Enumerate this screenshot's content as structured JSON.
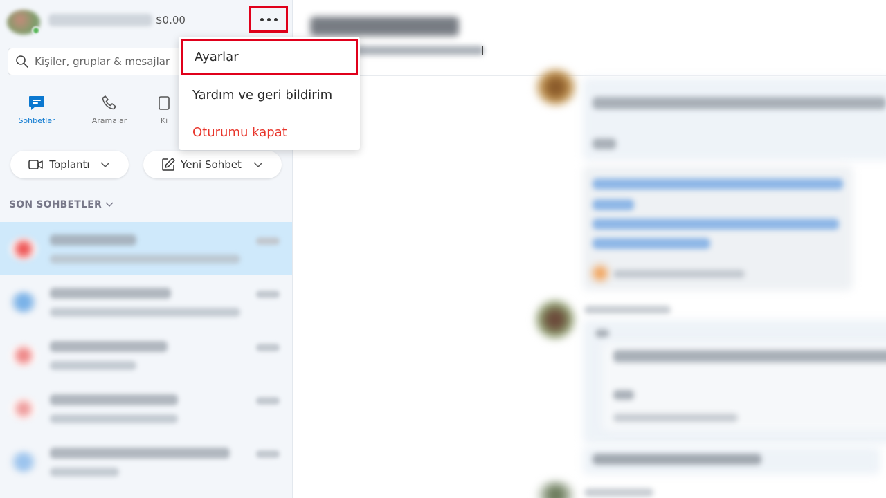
{
  "profile": {
    "credit": "$0.00"
  },
  "search": {
    "placeholder": "Kişiler, gruplar & mesajlar"
  },
  "nav": {
    "items": [
      {
        "label": "Sohbetler",
        "icon": "chat-icon",
        "active": true
      },
      {
        "label": "Aramalar",
        "icon": "phone-icon",
        "active": false
      },
      {
        "label": "Ki",
        "icon": "contacts-icon",
        "active": false
      }
    ]
  },
  "actions": {
    "meeting_label": "Toplantı",
    "new_chat_label": "Yeni Sohbet"
  },
  "recent": {
    "title": "SON SOHBETLER"
  },
  "menu": {
    "settings": "Ayarlar",
    "help": "Yardım ve geri bildirim",
    "logout": "Oturumu kapat"
  },
  "colors": {
    "accent": "#0b78d0",
    "highlight_border": "#e0001b",
    "logout_text": "#e8362c",
    "selected_row": "#cfe9fb",
    "sidebar_bg": "#f3f6fa"
  }
}
